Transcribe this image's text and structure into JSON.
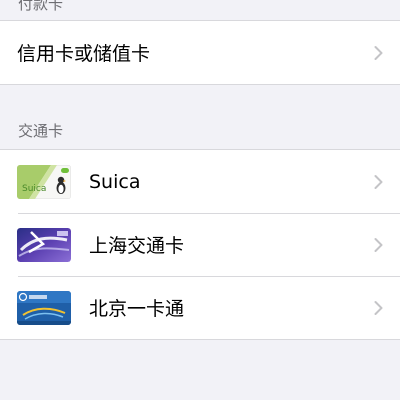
{
  "payment_section": {
    "header": "付款卡",
    "items": [
      {
        "label": "信用卡或储值卡"
      }
    ]
  },
  "transit_section": {
    "header": "交通卡",
    "cards": [
      {
        "label": "Suica",
        "thumb_text": "Suica",
        "icon": "suica-card-icon"
      },
      {
        "label": "上海交通卡",
        "icon": "shanghai-card-icon"
      },
      {
        "label": "北京一卡通",
        "icon": "beijing-card-icon"
      }
    ]
  },
  "colors": {
    "background": "#f2f2f7",
    "cell": "#ffffff",
    "separator": "#d8d8dc",
    "header_text": "#6d6d72",
    "chevron": "#c4c4c7"
  }
}
